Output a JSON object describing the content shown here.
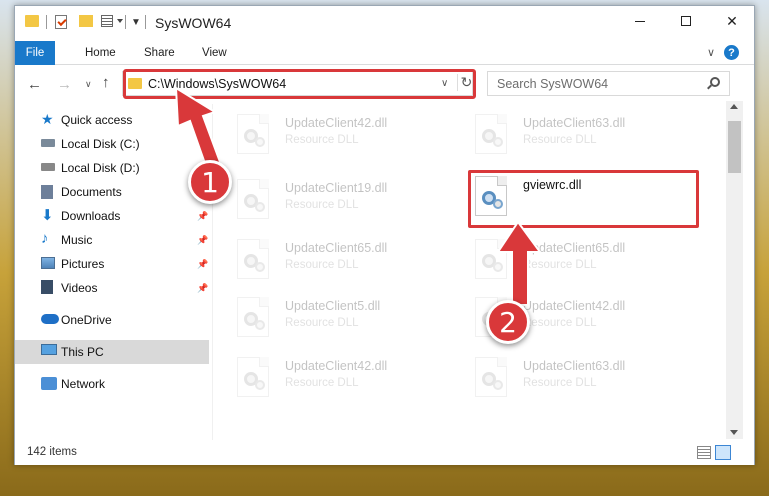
{
  "window": {
    "title": "SysWOW64",
    "minimize_label": "Minimize",
    "maximize_label": "Maximize",
    "close_label": "Close"
  },
  "ribbon": {
    "tabs": [
      "File",
      "Home",
      "Share",
      "View"
    ]
  },
  "address": {
    "path": "C:\\Windows\\SysWOW64"
  },
  "search": {
    "placeholder": "Search SysWOW64"
  },
  "sidebar": {
    "items": [
      {
        "label": "Quick access",
        "icon": "star-icon",
        "pinned": false
      },
      {
        "label": "Local Disk (C:)",
        "icon": "drive-icon",
        "pinned": false
      },
      {
        "label": "Local Disk (D:)",
        "icon": "drive-icon",
        "pinned": false
      },
      {
        "label": "Documents",
        "icon": "documents-icon",
        "pinned": false
      },
      {
        "label": "Downloads",
        "icon": "download-icon",
        "pinned": true
      },
      {
        "label": "Music",
        "icon": "music-icon",
        "pinned": true
      },
      {
        "label": "Pictures",
        "icon": "pictures-icon",
        "pinned": true
      },
      {
        "label": "Videos",
        "icon": "videos-icon",
        "pinned": true
      },
      {
        "label": "OneDrive",
        "icon": "onedrive-icon",
        "pinned": false
      },
      {
        "label": "This PC",
        "icon": "pc-icon",
        "pinned": false,
        "selected": true
      },
      {
        "label": "Network",
        "icon": "network-icon",
        "pinned": false
      }
    ]
  },
  "files": {
    "left": [
      {
        "name": "UpdateClient42.dll",
        "type": "Resource DLL"
      },
      {
        "name": "UpdateClient19.dll",
        "type": "Resource DLL"
      },
      {
        "name": "UpdateClient65.dll",
        "type": "Resource DLL"
      },
      {
        "name": "UpdateClient5.dll",
        "type": "Resource DLL"
      },
      {
        "name": "UpdateClient42.dll",
        "type": "Resource DLL"
      }
    ],
    "right": [
      {
        "name": "UpdateClient63.dll",
        "type": "Resource DLL"
      },
      {
        "name": "gviewrc.dll",
        "type": ""
      },
      {
        "name": "UpdateClient65.dll",
        "type": "Resource DLL"
      },
      {
        "name": "UpdateClient42.dll",
        "type": "Resource DLL"
      },
      {
        "name": "UpdateClient63.dll",
        "type": "Resource DLL"
      }
    ]
  },
  "status": {
    "count": "142 items"
  },
  "callouts": {
    "one": "1",
    "two": "2"
  },
  "colors": {
    "accent": "#1979ca",
    "highlight": "#d9383a"
  }
}
